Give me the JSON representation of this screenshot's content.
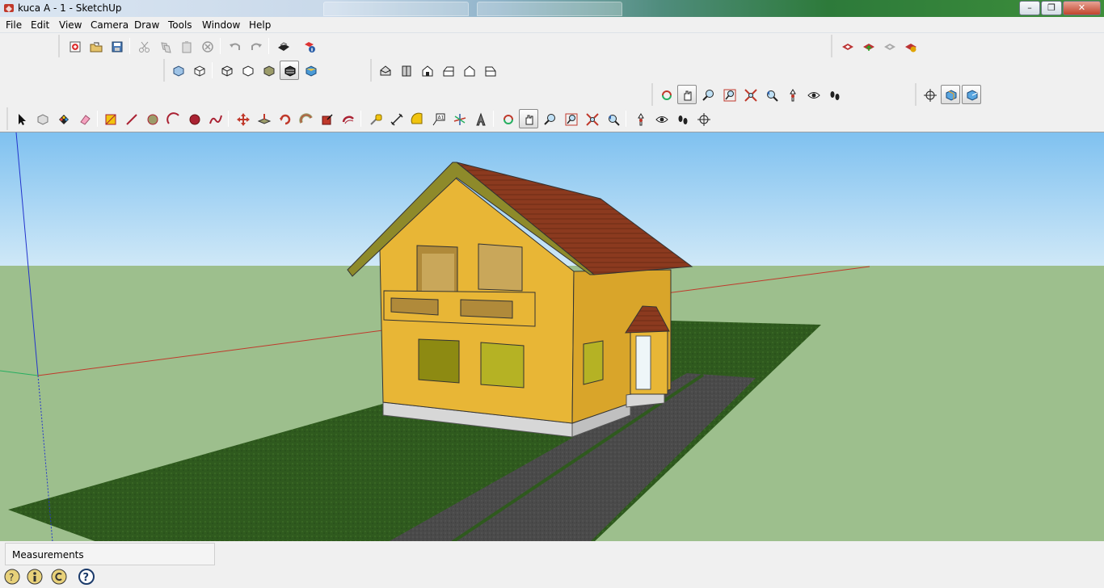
{
  "window": {
    "title": "kuca A - 1 - SketchUp",
    "controls": [
      "minimize",
      "maximize",
      "close"
    ]
  },
  "menu": {
    "items": [
      {
        "label": "File"
      },
      {
        "label": "Edit"
      },
      {
        "label": "View"
      },
      {
        "label": "Camera"
      },
      {
        "label": "Draw"
      },
      {
        "label": "Tools"
      },
      {
        "label": "Window"
      },
      {
        "label": "Help"
      }
    ]
  },
  "toolbars": {
    "standard": [
      "new-icon",
      "open-icon",
      "save-icon",
      "cut-icon",
      "copy-icon",
      "paste-icon",
      "erase-icon",
      "undo-icon",
      "redo-icon",
      "print-icon",
      "model-info-icon"
    ],
    "face_style": [
      "xray-icon",
      "wireframe-icon",
      "hidden-line-icon",
      "shaded-icon",
      "shaded-textures-icon",
      "monochrome-icon"
    ],
    "views": [
      "iso-view-icon",
      "top-view-icon",
      "front-view-icon",
      "right-view-icon",
      "back-view-icon",
      "left-view-icon"
    ],
    "warehouse": [
      "get-models-icon",
      "share-model-icon",
      "share-component-icon",
      "extension-warehouse-icon"
    ],
    "camera": [
      "orbit-icon",
      "pan-icon",
      "zoom-icon",
      "zoom-window-icon",
      "zoom-extents-icon",
      "previous-icon",
      "position-camera-icon",
      "look-around-icon",
      "walk-icon"
    ],
    "sandbox": [
      "section-plane-icon",
      "display-section-planes-icon",
      "display-section-cuts-icon"
    ],
    "large_tool_set": [
      "select-icon",
      "make-component-icon",
      "paint-bucket-icon",
      "eraser-icon",
      "rectangle-icon",
      "line-icon",
      "circle-icon",
      "arc-icon",
      "polygon-icon",
      "freehand-icon",
      "move-icon",
      "push-pull-icon",
      "rotate-icon",
      "follow-me-icon",
      "scale-icon",
      "offset-icon",
      "tape-measure-icon",
      "dimension-icon",
      "protractor-icon",
      "text-icon",
      "axes-icon",
      "3d-text-icon",
      "orbit-icon",
      "pan-icon",
      "zoom-icon",
      "zoom-window-icon",
      "zoom-extents-icon",
      "previous-icon",
      "position-camera-icon",
      "look-around-icon",
      "walk-icon",
      "section-plane-icon"
    ]
  },
  "colors": {
    "sky": "#86c6f2",
    "ground": "#9dbf8d",
    "lawn": "#2f5a1e",
    "walls": "#e8b636",
    "roof": "#8b3a1f",
    "path": "#4a4a4a"
  },
  "status": {
    "measurements_label": "Measurements"
  }
}
